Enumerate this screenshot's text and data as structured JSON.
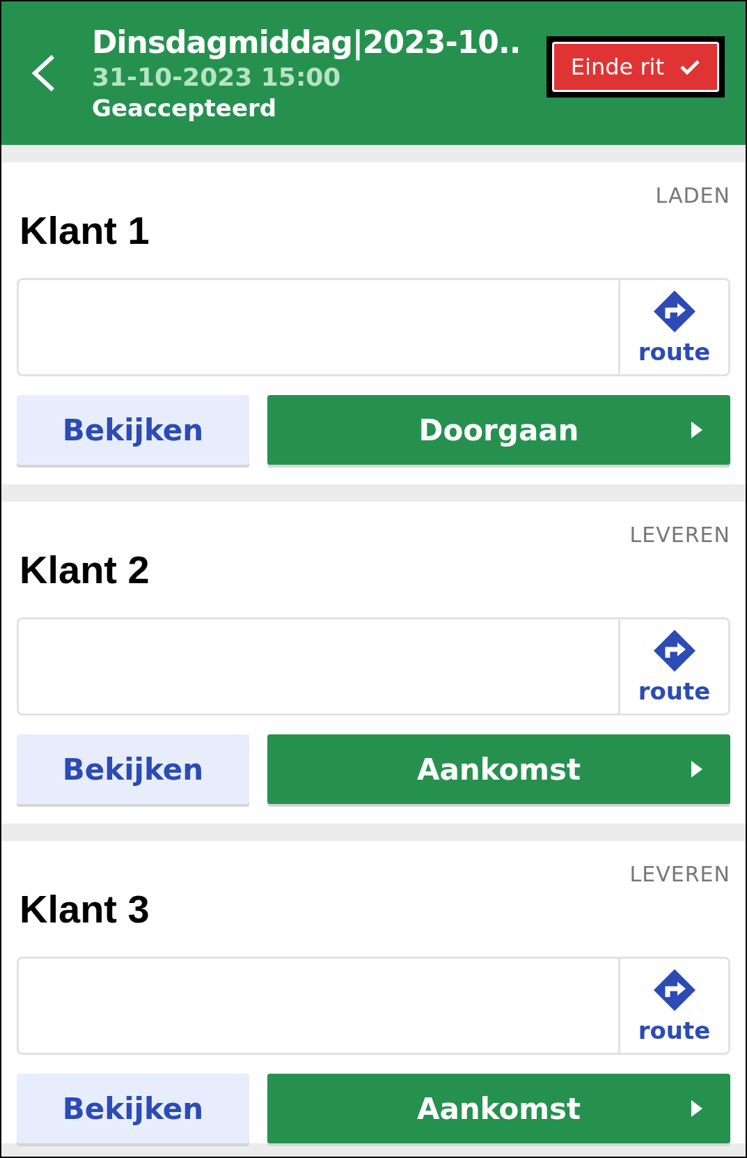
{
  "header": {
    "title": "Dinsdagmiddag|2023-10..",
    "datetime": "31-10-2023 15:00",
    "status": "Geaccepteerd",
    "end_button": "Einde rit"
  },
  "stops": [
    {
      "name": "Klant 1",
      "stage": "LADEN",
      "route_label": "route",
      "view_button": "Bekijken",
      "action_button": "Doorgaan"
    },
    {
      "name": "Klant 2",
      "stage": "LEVEREN",
      "route_label": "route",
      "view_button": "Bekijken",
      "action_button": "Aankomst"
    },
    {
      "name": "Klant 3",
      "stage": "LEVEREN",
      "route_label": "route",
      "view_button": "Bekijken",
      "action_button": "Aankomst"
    }
  ]
}
